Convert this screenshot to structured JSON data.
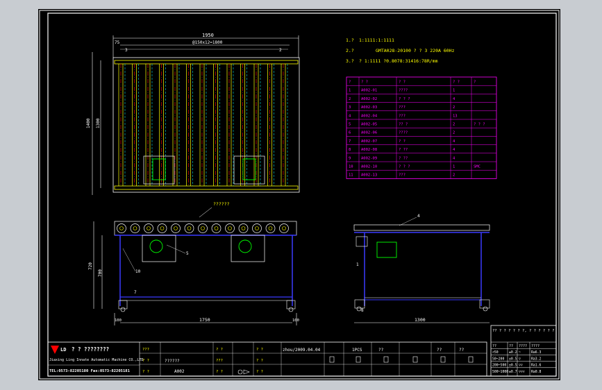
{
  "colors": {
    "background": "#c8ccd1",
    "sheet": "#000000",
    "frame": "#ffffff",
    "yellow": "#ffff00",
    "cyan": "#00ffff",
    "magenta": "#ff00ff",
    "red": "#ff0000",
    "green": "#00ff00",
    "blue": "#3a3aff"
  },
  "top_view": {
    "dim_overall_width": "1950",
    "dim_roller_pitch": "@150x12=1800",
    "dim_left_offset": "75",
    "dim_height_outer": "1400",
    "dim_height_inner": "1300",
    "label_2": "2",
    "label_3": "3"
  },
  "spec_notes": {
    "line1_label": "1.?",
    "line1_value": "1:1111:1:1111",
    "line2_label": "2.?",
    "line2_value": "GMTA028-20100 ? ? 3 220A 60Hz",
    "line3_label": "3.?",
    "line3_value": "? 1:1111 ?0.8078:31416:78R/mm"
  },
  "parts_table": {
    "headers": [
      "?",
      "? ?",
      "? ?",
      "? ?",
      "?"
    ],
    "rows": [
      [
        "1",
        "A002-01",
        "????",
        "1",
        ""
      ],
      [
        "2",
        "A002-02",
        "? ? ?",
        "4",
        ""
      ],
      [
        "3",
        "A002-03",
        "???",
        "2",
        ""
      ],
      [
        "4",
        "A002-04",
        "???",
        "13",
        ""
      ],
      [
        "5",
        "A002-05",
        "?? ?",
        "2",
        "? ? ?"
      ],
      [
        "6",
        "A002-06",
        "????",
        "2",
        ""
      ],
      [
        "7",
        "A002-07",
        "? ?",
        "4",
        ""
      ],
      [
        "8",
        "A002-08",
        "? ??",
        "4",
        ""
      ],
      [
        "9",
        "A002-09",
        "? ??",
        "4",
        ""
      ],
      [
        "10",
        "A002-10",
        "? ? ?",
        "1",
        "SMC"
      ],
      [
        "11",
        "A002-13",
        "???",
        "2",
        ""
      ]
    ]
  },
  "front_view": {
    "callout_label": "??????",
    "dim_left_1": "720",
    "dim_left_2": "700",
    "dim_bottom_total": "1750",
    "dim_bottom_left": "100",
    "dim_bottom_right": "100",
    "label_5": "5",
    "label_7": "7",
    "label_10": "10"
  },
  "side_view": {
    "dim_bottom": "1300",
    "label_1": "1",
    "label_4": "4",
    "label_8": "8"
  },
  "title_block": {
    "company_cn": "? ? ????????",
    "company_en": "Jiaxing Ling Innate Automatic Machine CO.,LTD",
    "phone": "TEL:0573-82205180  Fax:0573-82205181",
    "logo_text": "LD",
    "drawing_name": "??????",
    "drawing_number": "A002",
    "author_date": "zhou/2009.04.04",
    "qty": "1PCS",
    "material_label": "??",
    "weight_label": "??",
    "scale_label": "??",
    "cells": [
      "???",
      "? ?",
      "? ?",
      "? ?",
      "???",
      "? ?",
      "? ?",
      "? ?",
      "? ?"
    ]
  },
  "tolerance_table": {
    "note": "?? ? ? ? ? ? ?, ? ? ? ? ? ?",
    "headers": [
      "??",
      "??",
      "????",
      "????"
    ],
    "rows": [
      [
        "<50",
        "±0.2",
        "~",
        "Ra6.3"
      ],
      [
        "50~200",
        "±0.5",
        "▽",
        "Ra3.2"
      ],
      [
        "200~500",
        "±0.5",
        "▽▽",
        "Ra1.6"
      ],
      [
        "500~1000",
        "±0.7",
        "▽▽▽",
        "Ra0.8"
      ]
    ]
  }
}
